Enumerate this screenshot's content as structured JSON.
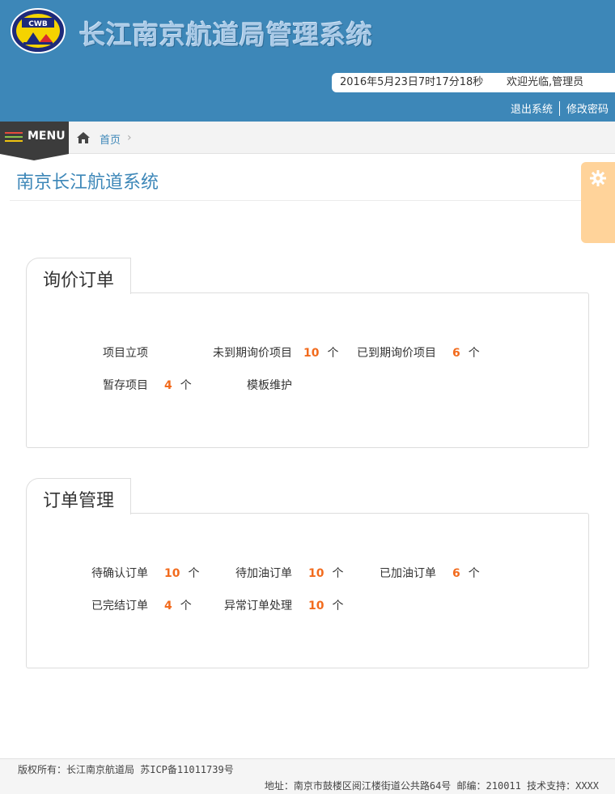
{
  "header": {
    "title": "长江南京航道局管理系统",
    "logo_text": "CWB",
    "datetime": "2016年5月23日7时17分18秒",
    "welcome": "欢迎光临,管理员",
    "logout_label": "退出系统",
    "change_password_label": "修改密码"
  },
  "nav": {
    "menu_label": "MENU",
    "breadcrumb_home": "首页",
    "breadcrumb_sep": "›"
  },
  "page": {
    "title": "南京长江航道系统"
  },
  "panels": [
    {
      "title": "询价订单",
      "items": [
        {
          "label": "项目立项"
        },
        {
          "label": "未到期询价项目",
          "count": "10",
          "unit": "个"
        },
        {
          "label": "已到期询价项目",
          "count": "6",
          "unit": "个"
        },
        {
          "label": "暂存项目",
          "count": "4",
          "unit": "个"
        },
        {
          "label": "模板维护"
        }
      ]
    },
    {
      "title": "订单管理",
      "items": [
        {
          "label": "待确认订单",
          "count": "10",
          "unit": "个"
        },
        {
          "label": "待加油订单",
          "count": "10",
          "unit": "个"
        },
        {
          "label": "已加油订单",
          "count": "6",
          "unit": "个"
        },
        {
          "label": "已完结订单",
          "count": "4",
          "unit": "个"
        },
        {
          "label": "异常订单处理",
          "count": "10",
          "unit": "个"
        }
      ]
    }
  ],
  "footer": {
    "copyright": "版权所有：长江南京航道局 苏ICP备11011739号",
    "address": "地址：南京市鼓楼区阅江楼街道公共路64号 邮编：210011 技术支持：XXXX"
  },
  "colors": {
    "header_bg": "#3d87b8",
    "accent_count": "#f26b1d",
    "menu_bg": "#3c3c3c",
    "settings_tab": "#ffd39a"
  }
}
